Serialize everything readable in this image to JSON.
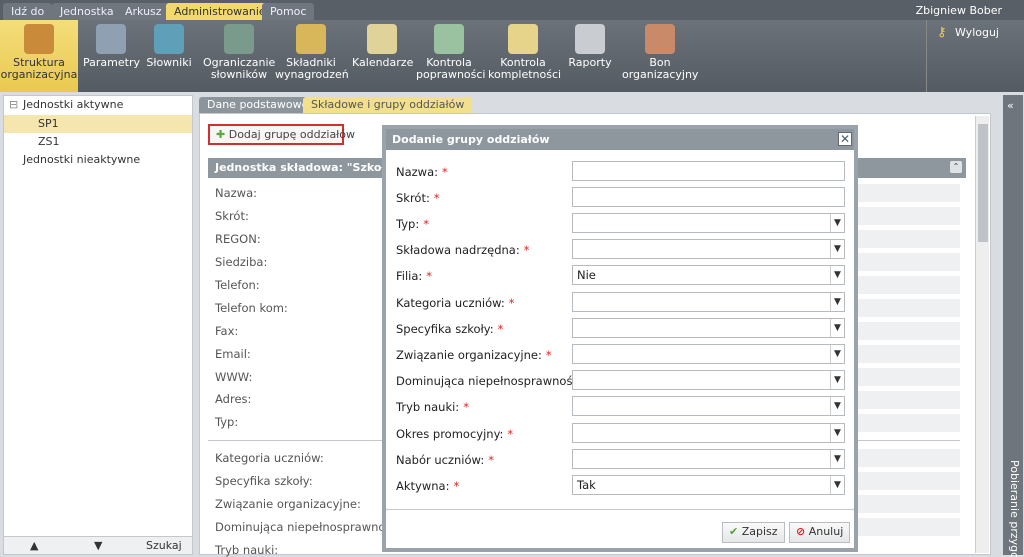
{
  "menu": {
    "items": [
      "Idź do",
      "Jednostka",
      "Arkusz",
      "Administrowanie",
      "Pomoc"
    ],
    "active": "Administrowanie",
    "user": "Zbigniew Bober"
  },
  "toolbar": {
    "items": [
      {
        "label1": "Struktura",
        "label2": "organizacyjna",
        "icon": "building-icon"
      },
      {
        "label1": "Parametry",
        "label2": "",
        "icon": "settings-icon"
      },
      {
        "label1": "Słowniki",
        "label2": "",
        "icon": "dictionary-icon"
      },
      {
        "label1": "Ograniczanie",
        "label2": "słowników",
        "icon": "restrict-dictionary-icon"
      },
      {
        "label1": "Składniki",
        "label2": "wynagrodzeń",
        "icon": "coins-icon"
      },
      {
        "label1": "Kalendarze",
        "label2": "",
        "icon": "calendar-icon"
      },
      {
        "label1": "Kontrola",
        "label2": "poprawności",
        "icon": "check-icon"
      },
      {
        "label1": "Kontrola",
        "label2": "kompletności",
        "icon": "warning-icon"
      },
      {
        "label1": "Raporty",
        "label2": "",
        "icon": "printer-icon"
      },
      {
        "label1": "Bon",
        "label2": "organizacyjny",
        "icon": "people-icon"
      }
    ],
    "logout": "Wyloguj"
  },
  "tree": {
    "active_units": "Jednostki aktywne",
    "sp1": "SP1",
    "zs1": "ZS1",
    "inactive_units": "Jednostki nieaktywne",
    "search": "Szukaj"
  },
  "tabs": {
    "basic": "Dane podstawowe",
    "groups": "Składowe i grupy oddziałów"
  },
  "main": {
    "add_button": "Dodaj grupę oddziałów",
    "section_title": "Jednostka składowa: \"Szkoła Po",
    "labels": [
      "Nazwa:",
      "Skrót:",
      "REGON:",
      "Siedziba:",
      "Telefon:",
      "Telefon kom:",
      "Fax:",
      "Email:",
      "WWW:",
      "Adres:",
      "Typ:"
    ],
    "labels2": [
      "Kategoria uczniów:",
      "Specyfika szkoły:",
      "Związanie organizacyjne:",
      "Dominująca niepełnosprawność:",
      "Tryb nauki:"
    ]
  },
  "right_panel": "Pobieranie przygotowanych plików",
  "modal": {
    "title": "Dodanie grupy oddziałów",
    "fields": [
      {
        "label": "Nazwa:",
        "value": "",
        "dropdown": false
      },
      {
        "label": "Skrót:",
        "value": "",
        "dropdown": false
      },
      {
        "label": "Typ:",
        "value": "",
        "dropdown": true
      },
      {
        "label": "Składowa nadrzędna:",
        "value": "",
        "dropdown": true
      },
      {
        "label": "Filia:",
        "value": "Nie",
        "dropdown": true
      },
      {
        "label": "Kategoria uczniów:",
        "value": "",
        "dropdown": true
      },
      {
        "label": "Specyfika szkoły:",
        "value": "",
        "dropdown": true
      },
      {
        "label": "Związanie organizacyjne:",
        "value": "",
        "dropdown": true
      },
      {
        "label": "Dominująca niepełnosprawność:",
        "value": "",
        "dropdown": true
      },
      {
        "label": "Tryb nauki:",
        "value": "",
        "dropdown": true
      },
      {
        "label": "Okres promocyjny:",
        "value": "",
        "dropdown": true
      },
      {
        "label": "Nabór uczniów:",
        "value": "",
        "dropdown": true
      },
      {
        "label": "Aktywna:",
        "value": "Tak",
        "dropdown": true
      }
    ],
    "required_mark": "*",
    "save": "Zapisz",
    "cancel": "Anuluj"
  }
}
